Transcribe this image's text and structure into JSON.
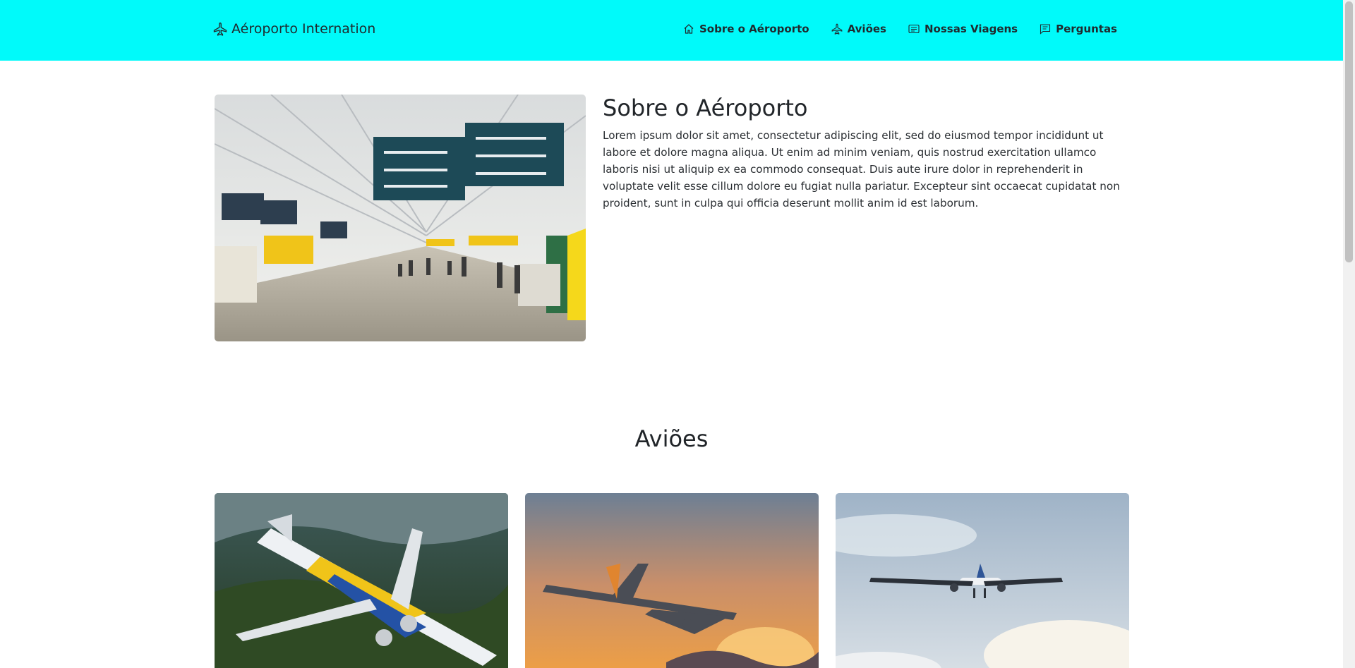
{
  "brand": {
    "label": "Aéroporto Internation",
    "icon": "airplane-icon"
  },
  "nav": {
    "items": [
      {
        "label": "Sobre o Aéroporto",
        "icon": "house-icon"
      },
      {
        "label": "Aviões",
        "icon": "airplane-icon"
      },
      {
        "label": "Nossas Viagens",
        "icon": "card-text-icon"
      },
      {
        "label": "Perguntas",
        "icon": "chat-text-icon"
      }
    ]
  },
  "about": {
    "title": "Sobre o Aéroporto",
    "body": "Lorem ipsum dolor sit amet, consectetur adipiscing elit, sed do eiusmod tempor incididunt ut labore et dolore magna aliqua. Ut enim ad minim veniam, quis nostrud exercitation ullamco laboris nisi ut aliquip ex ea commodo consequat. Duis aute irure dolor in reprehenderit in voluptate velit esse cillum dolore eu fugiat nulla pariatur. Excepteur sint occaecat cupidatat non proident, sunt in culpa qui officia deserunt mollit anim id est laborum."
  },
  "planes": {
    "title": "Aviões"
  },
  "colors": {
    "navbar": "#00fafa",
    "text": "#212529"
  }
}
